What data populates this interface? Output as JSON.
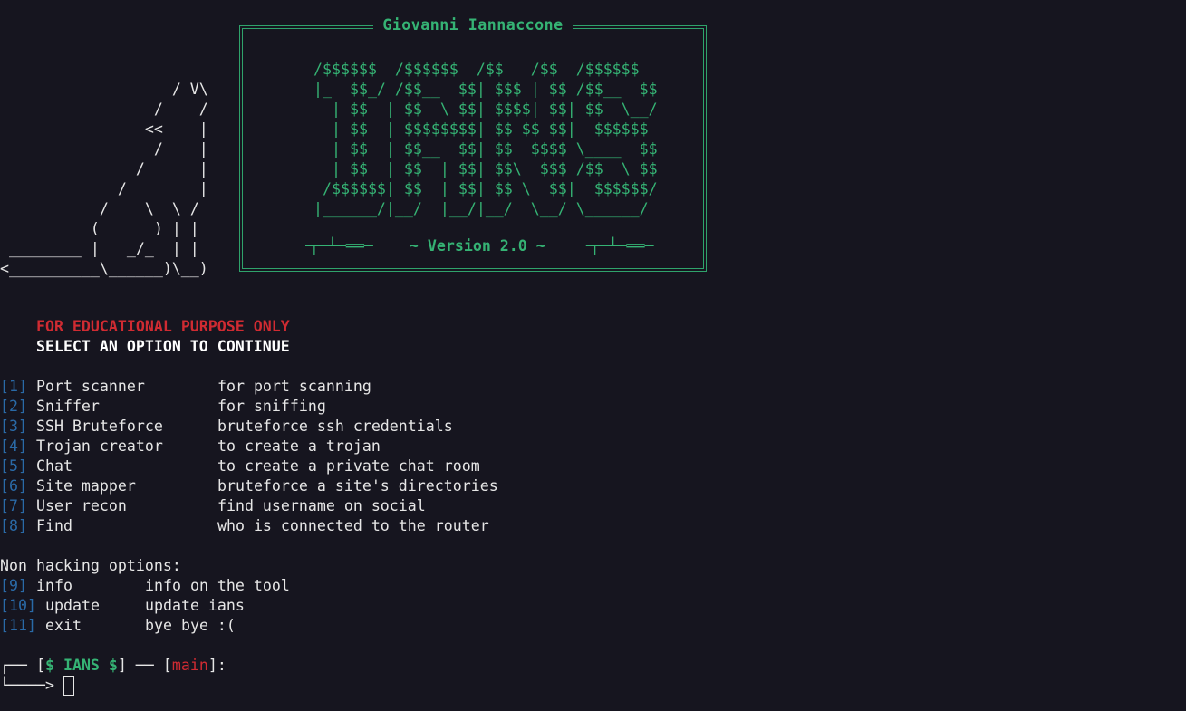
{
  "banner": {
    "title": "Giovanni Iannaccone",
    "version_text": "~ Version 2.0 ~",
    "wolf_ascii": "                   / V\\\n                 /    /\n                <<    |\n                 /    |\n               /      |\n             /        |\n           /    \\  \\ /\n          (      ) | |\n ________ |   _/_  | |\n<__________\\______)\\__)",
    "logo_ascii": "/$$$$$$  /$$$$$$  /$$   /$$  /$$$$$$\n|_  $$_/ /$$__  $$| $$$ | $$ /$$__  $$\n  | $$  | $$  \\ $$| $$$$| $$| $$  \\__/\n  | $$  | $$$$$$$$| $$ $$ $$|  $$$$$$\n  | $$  | $$__  $$| $$  $$$$ \\____  $$\n  | $$  | $$  | $$| $$\\  $$$ /$$  \\ $$\n /$$$$$$| $$  | $$| $$ \\  $$|  $$$$$$/\n|______/|__/  |__/|__/  \\__/ \\______/",
    "gun_left": "╶┬─┴─══─",
    "gun_right": "╶┬─┴─══─"
  },
  "notice": {
    "warning": "FOR EDUCATIONAL PURPOSE ONLY",
    "instruction": "SELECT AN OPTION TO CONTINUE"
  },
  "hacking_options": [
    {
      "num": "[1]",
      "label": "Port scanner",
      "desc": "for port scanning"
    },
    {
      "num": "[2]",
      "label": "Sniffer",
      "desc": "for sniffing"
    },
    {
      "num": "[3]",
      "label": "SSH Bruteforce",
      "desc": "bruteforce ssh credentials"
    },
    {
      "num": "[4]",
      "label": "Trojan creator",
      "desc": "to create a trojan"
    },
    {
      "num": "[5]",
      "label": "Chat",
      "desc": "to create a private chat room"
    },
    {
      "num": "[6]",
      "label": "Site mapper",
      "desc": "bruteforce a site's directories"
    },
    {
      "num": "[7]",
      "label": "User recon",
      "desc": "find username on social"
    },
    {
      "num": "[8]",
      "label": "Find",
      "desc": "who is connected to the router"
    }
  ],
  "non_hacking": {
    "heading": "Non hacking options:",
    "options": [
      {
        "num": "[9]",
        "label": "info",
        "desc": "info on the tool"
      },
      {
        "num": "[10]",
        "label": "update",
        "desc": "update ians"
      },
      {
        "num": "[11]",
        "label": "exit",
        "desc": "bye bye :("
      }
    ]
  },
  "prompt": {
    "corner_top": "┌──",
    "corner_bottom": "└────>",
    "tool": "$ IANS $",
    "separator": "─",
    "context": "main",
    "suffix": ":"
  },
  "colors": {
    "background": "#16151f",
    "green": "#35b374",
    "red": "#d02b32",
    "blue": "#2a6aa7",
    "text": "#e6e6e6"
  }
}
